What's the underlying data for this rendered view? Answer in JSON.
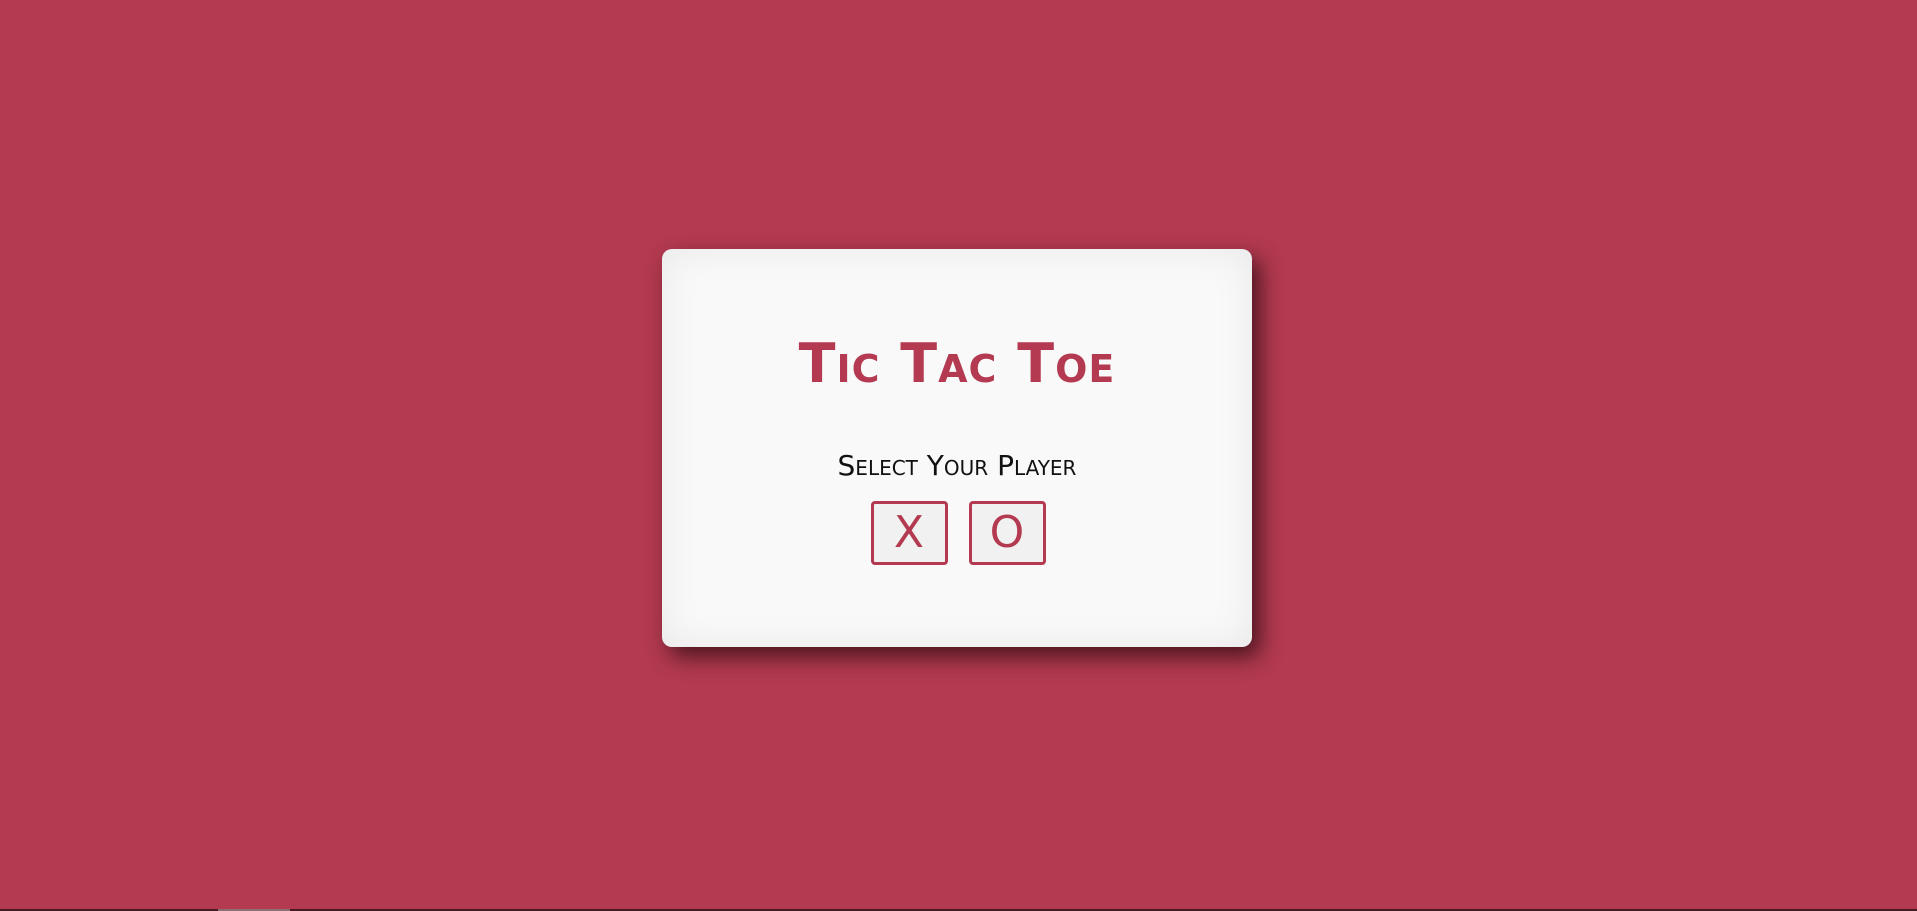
{
  "colors": {
    "background": "#b33a50",
    "card": "#f9f9f9",
    "accent": "#b33a50",
    "text": "#111111"
  },
  "game": {
    "title": "Tic Tac Toe",
    "prompt": "Select Your Player",
    "players": [
      {
        "label": "X"
      },
      {
        "label": "O"
      }
    ]
  }
}
